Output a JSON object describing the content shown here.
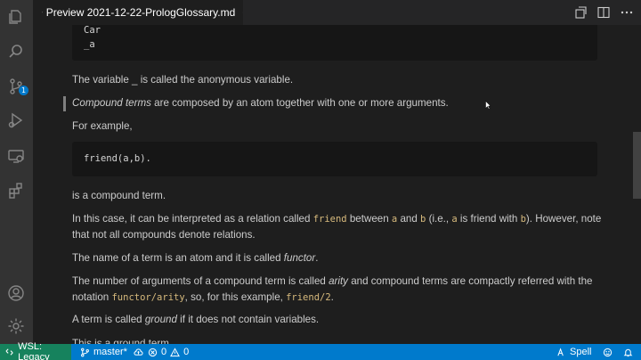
{
  "tab": {
    "title": "Preview 2021-12-22-PrologGlossary.md"
  },
  "activity_bar": {
    "scm_badge": "1"
  },
  "editor": {
    "code_top": {
      "line1": "Car",
      "line2": "_a"
    },
    "p_anonymous": "The variable _ is called the anonymous variable.",
    "compound_em": "Compound terms",
    "compound_rest": " are composed by an atom together with one or more arguments.",
    "for_example": "For example,",
    "code_friend": "friend(a,b).",
    "is_compound": "is a compound term.",
    "relation": {
      "t1": "In this case, it can be interpreted as a relation called ",
      "c1": "friend",
      "t2": " between ",
      "c2": "a",
      "t3": " and ",
      "c3": "b",
      "t4": " (i.e., ",
      "c4": "a",
      "t5": " is friend with ",
      "c5": "b",
      "t6": "). However, note",
      "line2": "that not all compounds denote relations."
    },
    "name_term": {
      "t1": "The name of a term is an atom and it is called ",
      "em": "functor",
      "t2": "."
    },
    "arity": {
      "t1": "The number of arguments of a compound term is called ",
      "em": "arity",
      "t2": " and compound terms are compactly referred with the",
      "t3": "notation ",
      "c1": "functor/arity",
      "t4": ", so, for this example, ",
      "c2": "friend/2",
      "t5": "."
    },
    "ground": {
      "t1": "A term is called ",
      "em": "ground",
      "t2": " if it does not contain variables."
    },
    "ground_example": "This is a ground term."
  },
  "status_bar": {
    "remote": "WSL: Legacy",
    "branch": "master*",
    "errors": "0",
    "warnings": "0",
    "spell": "Spell"
  },
  "colors": {
    "accent": "#007acc",
    "remote": "#16825d",
    "inline_code": "#d7ba7d",
    "background": "#1e1e1e"
  }
}
